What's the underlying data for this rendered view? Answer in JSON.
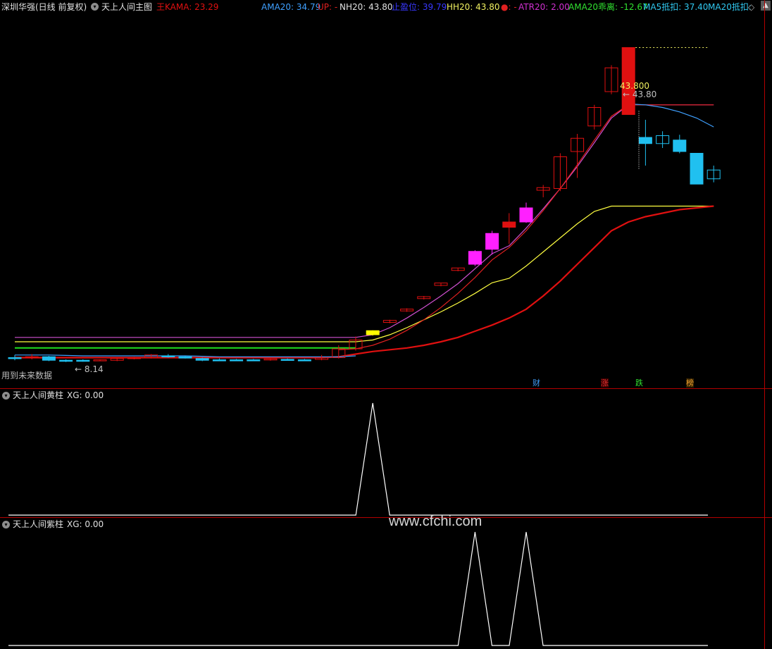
{
  "main_header": {
    "title": "深圳华强(日线 前复权)",
    "indicator": "天上人间主图",
    "kama_label": "王KAMA: 23.29",
    "ama20": "AMA20: 34.79",
    "up": "UP: -",
    "nh20": "NH20: 43.80",
    "stop": "止盈位: 39.79",
    "hh20": "HH20: 43.80",
    "dot": "●: -",
    "atr20": "ATR20: 2.00",
    "ama20_dev": "AMA20乖离: -12.67",
    "ma5": "MA5抵扣: 37.40",
    "ma20": "MA20抵扣:",
    "ma20_icon": "diamond-icon"
  },
  "annotations": {
    "high_value": "43.800",
    "high_label": "← 43.80",
    "low_label": "← 8.14",
    "future_data": "用到未来数据",
    "tag_cai": "财",
    "tag_zhang": "涨",
    "tag_die": "跌",
    "tag_bang": "榜"
  },
  "sub1_header": {
    "title": "天上人间黄柱",
    "value": "XG: 0.00"
  },
  "sub2_header": {
    "title": "天上人间紫柱",
    "value": "XG: 0.00"
  },
  "watermark": "www.cfchi.com",
  "colors": {
    "kama": "#e01010",
    "ama20": "#3fa0ff",
    "nh20": "#d050d0",
    "stop": "#3838ff",
    "hh20": "#f0f060",
    "atr": "#d030d0",
    "dev": "#30e030",
    "ma5": "#30c8f0",
    "ma20": "#30c8f0",
    "up_candle": "#e01010",
    "down_candle": "#20c0f0",
    "yellow_bar": "#ffff00",
    "purple_bar": "#ff20ff"
  },
  "chart_data": [
    {
      "type": "candlestick",
      "title": "",
      "ylim": [
        6,
        46
      ],
      "count": 41,
      "candles": [
        {
          "o": 8.6,
          "h": 8.9,
          "l": 8.3,
          "c": 8.5,
          "k": "down"
        },
        {
          "o": 8.6,
          "h": 9.0,
          "l": 8.4,
          "c": 8.7,
          "k": "up"
        },
        {
          "o": 8.7,
          "h": 8.8,
          "l": 8.2,
          "c": 8.3,
          "k": "down"
        },
        {
          "o": 8.3,
          "h": 8.4,
          "l": 8.1,
          "c": 8.2,
          "k": "down"
        },
        {
          "o": 8.3,
          "h": 8.4,
          "l": 8.14,
          "c": 8.2,
          "k": "down"
        },
        {
          "o": 8.3,
          "h": 8.4,
          "l": 8.2,
          "c": 8.35,
          "k": "up"
        },
        {
          "o": 8.3,
          "h": 8.6,
          "l": 8.2,
          "c": 8.5,
          "k": "up"
        },
        {
          "o": 8.5,
          "h": 8.7,
          "l": 8.4,
          "c": 8.6,
          "k": "up"
        },
        {
          "o": 8.6,
          "h": 9.0,
          "l": 8.5,
          "c": 8.9,
          "k": "up"
        },
        {
          "o": 8.8,
          "h": 9.0,
          "l": 8.6,
          "c": 8.75,
          "k": "down"
        },
        {
          "o": 8.7,
          "h": 8.8,
          "l": 8.5,
          "c": 8.55,
          "k": "down"
        },
        {
          "o": 8.5,
          "h": 8.6,
          "l": 8.2,
          "c": 8.3,
          "k": "down"
        },
        {
          "o": 8.35,
          "h": 8.5,
          "l": 8.25,
          "c": 8.3,
          "k": "down"
        },
        {
          "o": 8.35,
          "h": 8.45,
          "l": 8.25,
          "c": 8.3,
          "k": "down"
        },
        {
          "o": 8.35,
          "h": 8.45,
          "l": 8.25,
          "c": 8.3,
          "k": "down"
        },
        {
          "o": 8.35,
          "h": 8.5,
          "l": 8.25,
          "c": 8.45,
          "k": "up"
        },
        {
          "o": 8.4,
          "h": 8.5,
          "l": 8.25,
          "c": 8.3,
          "k": "down"
        },
        {
          "o": 8.35,
          "h": 8.45,
          "l": 8.2,
          "c": 8.3,
          "k": "down"
        },
        {
          "o": 8.4,
          "h": 8.9,
          "l": 8.3,
          "c": 8.6,
          "k": "up"
        },
        {
          "o": 8.6,
          "h": 10.0,
          "l": 8.5,
          "c": 9.6,
          "k": "up"
        },
        {
          "o": 9.6,
          "h": 11.0,
          "l": 9.4,
          "c": 10.6,
          "k": "up"
        },
        {
          "o": 11.2,
          "h": 11.7,
          "l": 11.1,
          "c": 11.66,
          "k": "yellow"
        },
        {
          "o": 12.6,
          "h": 12.9,
          "l": 12.5,
          "c": 12.83,
          "k": "up"
        },
        {
          "o": 13.9,
          "h": 14.2,
          "l": 13.8,
          "c": 14.11,
          "k": "up"
        },
        {
          "o": 15.3,
          "h": 15.6,
          "l": 15.2,
          "c": 15.52,
          "k": "up"
        },
        {
          "o": 16.8,
          "h": 17.1,
          "l": 16.7,
          "c": 17.07,
          "k": "up"
        },
        {
          "o": 18.5,
          "h": 18.8,
          "l": 18.4,
          "c": 18.78,
          "k": "up"
        },
        {
          "o": 19.2,
          "h": 20.8,
          "l": 19.0,
          "c": 20.66,
          "k": "purple"
        },
        {
          "o": 20.9,
          "h": 23.0,
          "l": 20.3,
          "c": 22.7,
          "k": "purple"
        },
        {
          "o": 23.4,
          "h": 25.0,
          "l": 21.5,
          "c": 24.0,
          "k": "upfill"
        },
        {
          "o": 24.0,
          "h": 26.2,
          "l": 23.9,
          "c": 25.6,
          "k": "purple"
        },
        {
          "o": 27.6,
          "h": 28.2,
          "l": 26.8,
          "c": 27.9,
          "k": "up"
        },
        {
          "o": 27.8,
          "h": 31.8,
          "l": 27.5,
          "c": 31.4,
          "k": "up"
        },
        {
          "o": 32.0,
          "h": 34.0,
          "l": 29.0,
          "c": 33.5,
          "k": "up"
        },
        {
          "o": 34.9,
          "h": 37.3,
          "l": 34.5,
          "c": 37.0,
          "k": "up"
        },
        {
          "o": 38.8,
          "h": 41.8,
          "l": 38.5,
          "c": 41.5,
          "k": "up"
        },
        {
          "o": 36.2,
          "h": 43.8,
          "l": 36.2,
          "c": 43.8,
          "k": "upfill"
        },
        {
          "o": 33.6,
          "h": 35.6,
          "l": 30.4,
          "c": 32.9,
          "k": "down"
        },
        {
          "o": 32.9,
          "h": 34.3,
          "l": 32.4,
          "c": 33.8,
          "k": "downhollow"
        },
        {
          "o": 33.3,
          "h": 33.9,
          "l": 31.8,
          "c": 32.0,
          "k": "down"
        },
        {
          "o": 31.8,
          "h": 31.8,
          "l": 28.3,
          "c": 28.3,
          "k": "down"
        },
        {
          "o": 28.9,
          "h": 30.4,
          "l": 28.5,
          "c": 29.9,
          "k": "downhollow"
        }
      ],
      "series": [
        {
          "name": "NH20",
          "color": "#d050d0",
          "values": [
            10.9,
            10.9,
            10.9,
            10.9,
            10.9,
            10.9,
            10.9,
            10.9,
            10.9,
            10.9,
            10.9,
            10.9,
            10.9,
            10.9,
            10.9,
            10.9,
            10.9,
            10.9,
            10.9,
            10.9,
            10.9,
            11.2,
            12.0,
            13.1,
            14.3,
            15.6,
            17.0,
            18.7,
            20.4,
            21.3,
            23.3,
            25.5,
            27.8,
            30.3,
            33.0,
            35.8,
            37.3,
            37.3,
            37.3,
            37.3,
            37.3,
            37.3
          ]
        },
        {
          "name": "HH20",
          "color": "#ffff40",
          "values": [
            10.4,
            10.4,
            10.4,
            10.4,
            10.4,
            10.4,
            10.4,
            10.4,
            10.4,
            10.4,
            10.4,
            10.4,
            10.4,
            10.4,
            10.4,
            10.4,
            10.4,
            10.4,
            10.4,
            10.4,
            10.4,
            10.6,
            11.2,
            12.0,
            12.9,
            13.8,
            14.8,
            15.9,
            17.1,
            17.6,
            19.0,
            20.6,
            22.2,
            23.8,
            25.2,
            25.8,
            25.8,
            25.8,
            25.8,
            25.8,
            25.8,
            25.8
          ]
        },
        {
          "name": "UP",
          "color": "#e02020",
          "values": [
            null,
            null,
            null,
            null,
            null,
            null,
            null,
            null,
            null,
            null,
            null,
            null,
            null,
            null,
            null,
            null,
            null,
            null,
            null,
            9.5,
            9.6,
            10.0,
            10.7,
            11.7,
            12.9,
            14.3,
            15.9,
            17.7,
            19.7,
            21.1,
            23.0,
            25.3,
            27.8,
            30.5,
            33.3,
            36.0,
            37.3,
            37.3,
            37.3,
            37.3,
            37.3,
            37.3
          ]
        },
        {
          "name": "AMA20",
          "color": "#3fa0ff",
          "values": [
            null,
            null,
            null,
            null,
            null,
            null,
            null,
            null,
            null,
            null,
            null,
            null,
            null,
            null,
            null,
            null,
            null,
            null,
            null,
            null,
            null,
            null,
            null,
            null,
            null,
            null,
            null,
            null,
            null,
            null,
            null,
            null,
            null,
            null,
            null,
            null,
            37.4,
            37.3,
            37.0,
            36.5,
            35.8,
            34.79
          ]
        },
        {
          "name": "KAMA",
          "color": "#e01010",
          "values": [
            8.6,
            8.6,
            8.6,
            8.6,
            8.6,
            8.6,
            8.6,
            8.6,
            8.6,
            8.6,
            8.6,
            8.6,
            8.6,
            8.6,
            8.6,
            8.6,
            8.6,
            8.6,
            8.6,
            8.7,
            9.0,
            9.3,
            9.5,
            9.7,
            10.0,
            10.4,
            10.9,
            11.6,
            12.3,
            13.1,
            14.1,
            15.6,
            17.3,
            19.2,
            21.1,
            23.0,
            24.0,
            24.6,
            25.0,
            25.4,
            25.6,
            25.8
          ]
        },
        {
          "name": "green",
          "color": "#20e020",
          "values": [
            9.7,
            9.7,
            9.7,
            9.7,
            9.7,
            9.7,
            9.7,
            9.7,
            9.7,
            9.7,
            9.7,
            9.7,
            9.7,
            9.7,
            9.7,
            9.7,
            9.7,
            9.7,
            9.7,
            9.7,
            9.7
          ]
        },
        {
          "name": "blue",
          "color": "#3fa0ff",
          "values": [
            8.9,
            8.9,
            8.9,
            8.85,
            8.8,
            8.8,
            8.8,
            8.8,
            8.8,
            8.8,
            8.8,
            8.75,
            8.7,
            8.7,
            8.7,
            8.7,
            8.7,
            8.7,
            8.7,
            8.7,
            8.8
          ]
        }
      ]
    },
    {
      "type": "line",
      "title": "天上人间黄柱",
      "ylim": [
        0,
        1
      ],
      "x": [
        0,
        1,
        2,
        3,
        4,
        5,
        6,
        7,
        8,
        9,
        10,
        11,
        12,
        13,
        14,
        15,
        16,
        17,
        18,
        19,
        20,
        21,
        22,
        23,
        24,
        25,
        26,
        27,
        28,
        29,
        30,
        31,
        32,
        33,
        34,
        35,
        36,
        37,
        38,
        39,
        40,
        41
      ],
      "values": [
        0,
        0,
        0,
        0,
        0,
        0,
        0,
        0,
        0,
        0,
        0,
        0,
        0,
        0,
        0,
        0,
        0,
        0,
        0,
        0,
        0,
        1,
        0,
        0,
        0,
        0,
        0,
        0,
        0,
        0,
        0,
        0,
        0,
        0,
        0,
        0,
        0,
        0,
        0,
        0,
        0,
        0
      ]
    },
    {
      "type": "line",
      "title": "天上人间紫柱",
      "ylim": [
        0,
        1
      ],
      "x": [
        0,
        1,
        2,
        3,
        4,
        5,
        6,
        7,
        8,
        9,
        10,
        11,
        12,
        13,
        14,
        15,
        16,
        17,
        18,
        19,
        20,
        21,
        22,
        23,
        24,
        25,
        26,
        27,
        28,
        29,
        30,
        31,
        32,
        33,
        34,
        35,
        36,
        37,
        38,
        39,
        40,
        41
      ],
      "values": [
        0,
        0,
        0,
        0,
        0,
        0,
        0,
        0,
        0,
        0,
        0,
        0,
        0,
        0,
        0,
        0,
        0,
        0,
        0,
        0,
        0,
        0,
        0,
        0,
        0,
        0,
        0,
        1,
        0,
        0,
        1,
        0,
        0,
        0,
        0,
        0,
        0,
        0,
        0,
        0,
        0,
        0
      ]
    }
  ]
}
